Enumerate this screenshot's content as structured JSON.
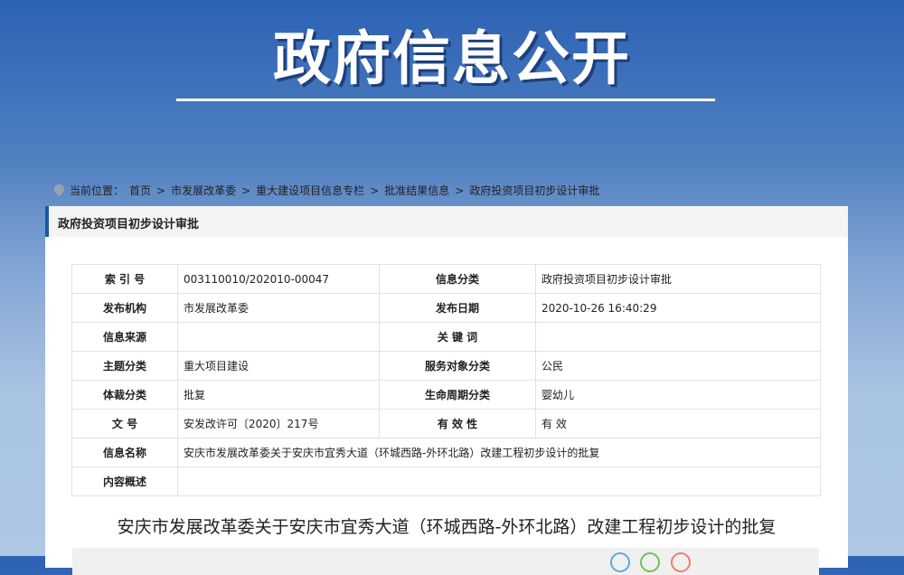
{
  "banner": {
    "title": "政府信息公开"
  },
  "breadcrumb": {
    "label": "当前位置：",
    "items": [
      "首页",
      "市发展改革委",
      "重大建设项目信息专栏",
      "批准结果信息",
      "政府投资项目初步设计审批"
    ]
  },
  "panel": {
    "title": "政府投资项目初步设计审批"
  },
  "meta": [
    {
      "k1": "索 引 号",
      "v1": "003110010/202010-00047",
      "k2": "信息分类",
      "v2": "政府投资项目初步设计审批"
    },
    {
      "k1": "发布机构",
      "v1": "市发展改革委",
      "k2": "发布日期",
      "v2": "2020-10-26 16:40:29"
    },
    {
      "k1": "信息来源",
      "v1": "",
      "k2": "关 键 词",
      "v2": ""
    },
    {
      "k1": "主题分类",
      "v1": "重大项目建设",
      "k2": "服务对象分类",
      "v2": "公民"
    },
    {
      "k1": "体裁分类",
      "v1": "批复",
      "k2": "生命周期分类",
      "v2": "婴幼儿"
    },
    {
      "k1": "文    号",
      "v1": "安发改许可〔2020〕217号",
      "k2": "有 效 性",
      "v2": "有 效"
    }
  ],
  "meta_wide": [
    {
      "k": "信息名称",
      "v": "安庆市发展改革委关于安庆市宜秀大道（环城西路-外环北路）改建工程初步设计的批复"
    },
    {
      "k": "内容概述",
      "v": ""
    }
  ],
  "document": {
    "title": "安庆市发展改革委关于安庆市宜秀大道（环城西路-外环北路）改建工程初步设计的批复"
  },
  "share_colors": [
    "#5aaae0",
    "#6cc25a",
    "#e8806a"
  ]
}
